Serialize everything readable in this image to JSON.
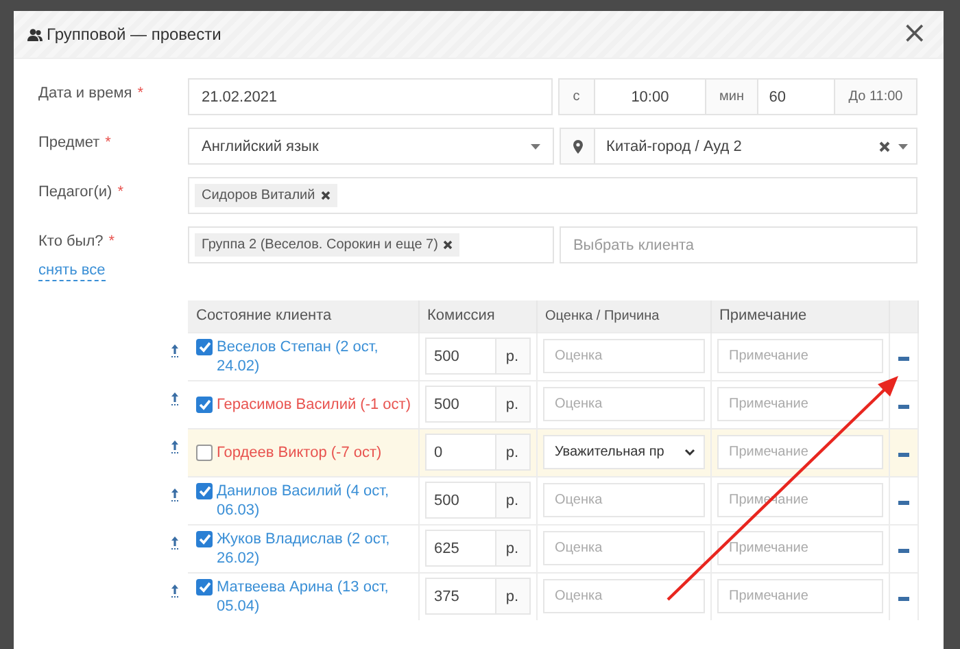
{
  "dialog": {
    "title": "Групповой — провести",
    "close": "×"
  },
  "form": {
    "date": {
      "label": "Дата и время",
      "required_mark": "*",
      "value": "21.02.2021",
      "from_label": "с",
      "time": "10:00",
      "min_label": "мин",
      "minutes": "60",
      "until": "До 11:00"
    },
    "subject": {
      "label": "Предмет",
      "required_mark": "*",
      "value": "Английский язык",
      "location": "Китай-город / Ауд 2"
    },
    "teachers": {
      "label": "Педагог(и)",
      "required_mark": "*",
      "tags": [
        "Сидоров Виталий"
      ]
    },
    "attendees": {
      "label": "Кто был?",
      "required_mark": "*",
      "tags": [
        "Группа 2 (Веселов. Сорокин и еще 7)"
      ],
      "client_placeholder": "Выбрать клиента",
      "clear_link": "снять все"
    }
  },
  "table": {
    "columns": [
      "Состояние клиента",
      "Комиссия",
      "Оценка / Причина",
      "Примечание"
    ],
    "rows": [
      {
        "name": "Веселов Степан (2 ост, 24.02)",
        "color": "#3a8fd6",
        "checked": true,
        "highlighted": false,
        "commission": "500",
        "unit": "р.",
        "grade": {
          "kind": "input",
          "placeholder": "Оценка"
        },
        "note_placeholder": "Примечание"
      },
      {
        "name": "Герасимов Василий (-1 ост)",
        "color": "#e8534f",
        "checked": true,
        "highlighted": false,
        "commission": "500",
        "unit": "р.",
        "grade": {
          "kind": "input",
          "placeholder": "Оценка"
        },
        "note_placeholder": "Примечание"
      },
      {
        "name": "Гордеев Виктор (-7 ост)",
        "color": "#e8534f",
        "checked": false,
        "highlighted": true,
        "commission": "0",
        "unit": "р.",
        "grade": {
          "kind": "select",
          "value": "Уважительная пр"
        },
        "note_placeholder": "Примечание"
      },
      {
        "name": "Данилов Василий (4 ост, 06.03)",
        "color": "#3a8fd6",
        "checked": true,
        "highlighted": false,
        "commission": "500",
        "unit": "р.",
        "grade": {
          "kind": "input",
          "placeholder": "Оценка"
        },
        "note_placeholder": "Примечание"
      },
      {
        "name": "Жуков Владислав (2 ост, 26.02)",
        "color": "#3a8fd6",
        "checked": true,
        "highlighted": false,
        "commission": "625",
        "unit": "р.",
        "grade": {
          "kind": "input",
          "placeholder": "Оценка"
        },
        "note_placeholder": "Примечание"
      },
      {
        "name": "Матвеева Арина (13 ост, 05.04)",
        "color": "#3a8fd6",
        "checked": true,
        "highlighted": false,
        "commission": "375",
        "unit": "р.",
        "grade": {
          "kind": "input",
          "placeholder": "Оценка"
        },
        "note_placeholder": "Примечание"
      }
    ]
  }
}
